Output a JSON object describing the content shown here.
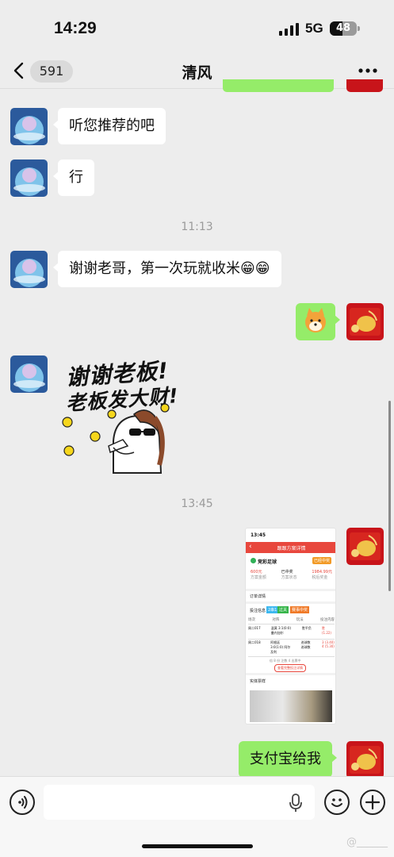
{
  "status_bar": {
    "time": "14:29",
    "network": "5G",
    "battery": "48",
    "battery_level": 0.48
  },
  "nav": {
    "unread_count": "591",
    "title": "清风"
  },
  "messages": [
    {
      "text": "听您推荐的吧"
    },
    {
      "text": "行"
    },
    {
      "text": "谢谢老哥，第一次玩就收米😁😁"
    },
    {
      "text": "支付宝给我"
    }
  ],
  "timestamps": [
    "11:13",
    "13:45"
  ],
  "sticker": {
    "line1": "谢谢老板!",
    "line2": "老板发大财!"
  },
  "screenshot": {
    "time": "13:45",
    "header": "跟跟方案详情",
    "store": "竞彩足球",
    "badge": "已经中奖",
    "stats": [
      {
        "value": "600元",
        "label": "方案金额"
      },
      {
        "value": "已中奖",
        "label": "方案状态"
      },
      {
        "value": "1984.99元",
        "label": "税后奖金"
      }
    ],
    "section_order": "订单详情",
    "section_plan": "投注信息",
    "tags": [
      "2串1",
      "过关",
      "赛事中奖"
    ],
    "columns": [
      "场次",
      "对阵",
      "玩法",
      "投注内容"
    ],
    "rows": [
      {
        "match": "周二017",
        "teams": "温莫 3:1(0:0) 曼内加尔",
        "play": "胜平负",
        "pick": "胜 (1.22)"
      },
      {
        "match": "周二018",
        "teams": "阿根廷 3:0(1:0) 阿尔及利",
        "play": "进球数 进球数",
        "pick": "3 (3.40) 4 (5.30)"
      }
    ],
    "footer_note": "倍 8 份  注数 4  出票中",
    "view_btn": "查看完整投注详情",
    "section_receipt": "实体票样"
  },
  "input": {
    "placeholder": ""
  },
  "watermark": "@______"
}
